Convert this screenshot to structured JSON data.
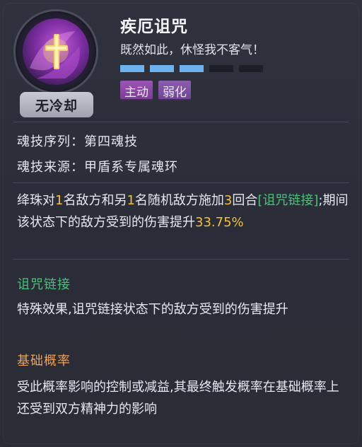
{
  "skill": {
    "title": "疾厄诅咒",
    "quote": "既然如此，休怪我不客气！",
    "cooldown": "无冷却",
    "level_bars": {
      "filled": 3,
      "total": 5
    },
    "tags": [
      "主动",
      "弱化"
    ]
  },
  "info": {
    "order_label": "魂技序列：",
    "order_value": "第四魂技",
    "source_label": "魂技来源：",
    "source_value": "甲盾系专属魂环"
  },
  "description": {
    "p1": "绛珠对",
    "n1": "1",
    "p2": "名敌方和另",
    "n2": "1",
    "p3": "名随机敌方施加",
    "n3": "3",
    "p4": "回合",
    "link": "[诅咒链接]",
    "p5": ";期间该状态下的敌方受到的伤害提升",
    "value": "33.75%"
  },
  "sections": [
    {
      "title": "诅咒链接",
      "text": "特殊效果,诅咒链接状态下的敌方受到的伤害提升"
    },
    {
      "title": "基础概率",
      "text": "受此概率影响的控制或减益,其最终触发概率在基础概率上还受到双方精神力的影响"
    }
  ],
  "colors": {
    "highlight": "#f4c132",
    "green_link": "#4bc07b",
    "orange_title": "#f0a050",
    "bar_filled": "#6cb2ef",
    "tag_purple": "#8a4aa8"
  }
}
